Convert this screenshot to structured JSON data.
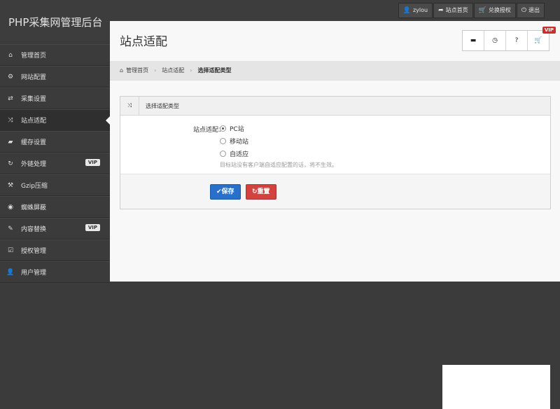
{
  "brand": {
    "title": "PHP采集网管理后台"
  },
  "topbar": {
    "links": [
      {
        "icon": "user-icon",
        "glyph": "👤",
        "label": "zylou"
      },
      {
        "icon": "share-icon",
        "glyph": "➦",
        "label": "站点首页"
      },
      {
        "icon": "cart-icon",
        "glyph": "🛒",
        "label": "兑换授权"
      },
      {
        "icon": "power-icon",
        "glyph": "⏻",
        "label": "退出"
      }
    ]
  },
  "sidebar": {
    "items": [
      {
        "icon": "home-icon",
        "glyph": "⌂",
        "label": "管理首页"
      },
      {
        "icon": "gear-icon",
        "glyph": "⚙",
        "label": "网站配置"
      },
      {
        "icon": "retweet-icon",
        "glyph": "⇄",
        "label": "采集设置"
      },
      {
        "icon": "random-icon",
        "glyph": "⤨",
        "label": "站点适配",
        "active": true
      },
      {
        "icon": "folder-open-icon",
        "glyph": "▰",
        "label": "缓存设置"
      },
      {
        "icon": "refresh-icon",
        "glyph": "↻",
        "label": "外链处理",
        "vip": "VIP"
      },
      {
        "icon": "wrench-icon",
        "glyph": "⚒",
        "label": "Gzip压缩"
      },
      {
        "icon": "eye-icon",
        "glyph": "◉",
        "label": "蜘蛛屏蔽"
      },
      {
        "icon": "pencil-icon",
        "glyph": "✎",
        "label": "内容替换",
        "vip": "VIP"
      },
      {
        "icon": "check-icon",
        "glyph": "☑",
        "label": "授权管理"
      },
      {
        "icon": "user-icon",
        "glyph": "👤",
        "label": "用户管理"
      }
    ]
  },
  "header": {
    "title": "站点适配",
    "vip_badge": "VIP",
    "buttons": [
      {
        "icon": "comment-icon",
        "glyph": "▬"
      },
      {
        "icon": "clock-icon",
        "glyph": "◷"
      },
      {
        "icon": "question-icon",
        "glyph": "?"
      },
      {
        "icon": "cart-icon",
        "glyph": "🛒"
      }
    ]
  },
  "breadcrumb": {
    "items": [
      "管理首页",
      "站点适配",
      "选择适配类型"
    ],
    "separator": "›"
  },
  "widget": {
    "title": "选择适配类型",
    "title_icon": "⤨",
    "field_label": "站点适配：",
    "options": [
      {
        "label": "PC站",
        "checked": true
      },
      {
        "label": "移动站",
        "checked": false
      },
      {
        "label": "自适应",
        "checked": false
      }
    ],
    "hint": "目标站没有客户端自适应配置的话，将不生效。",
    "save_label": "✔保存",
    "reset_label": "↻重置"
  }
}
